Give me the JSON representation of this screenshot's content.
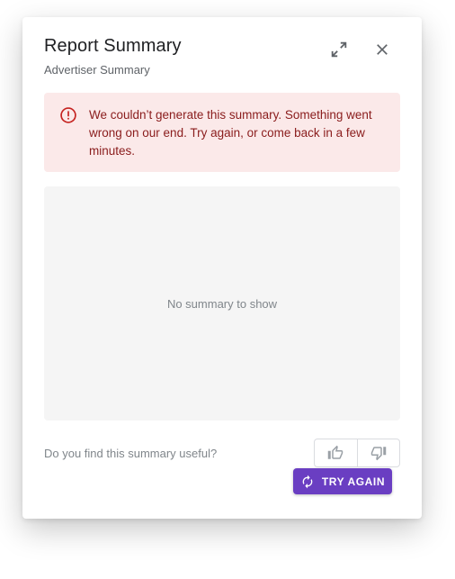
{
  "dialog": {
    "title": "Report Summary",
    "subtitle": "Advertiser Summary",
    "icons": {
      "expand": "expand-icon",
      "close": "close-icon"
    }
  },
  "error": {
    "icon": "error-icon",
    "message": "We couldn’t generate this summary. Something went wrong on our end. Try again, or come back in a few minutes.",
    "color": "#8a1c1c",
    "background": "#fbe9e9"
  },
  "summary": {
    "empty_text": "No summary to show"
  },
  "feedback": {
    "question": "Do you find this summary useful?",
    "thumbs_up_icon": "thumbs-up-icon",
    "thumbs_down_icon": "thumbs-down-icon"
  },
  "actions": {
    "try_again_label": "TRY AGAIN",
    "try_again_icon": "refresh-icon",
    "accent_color": "#6a3ec2"
  }
}
